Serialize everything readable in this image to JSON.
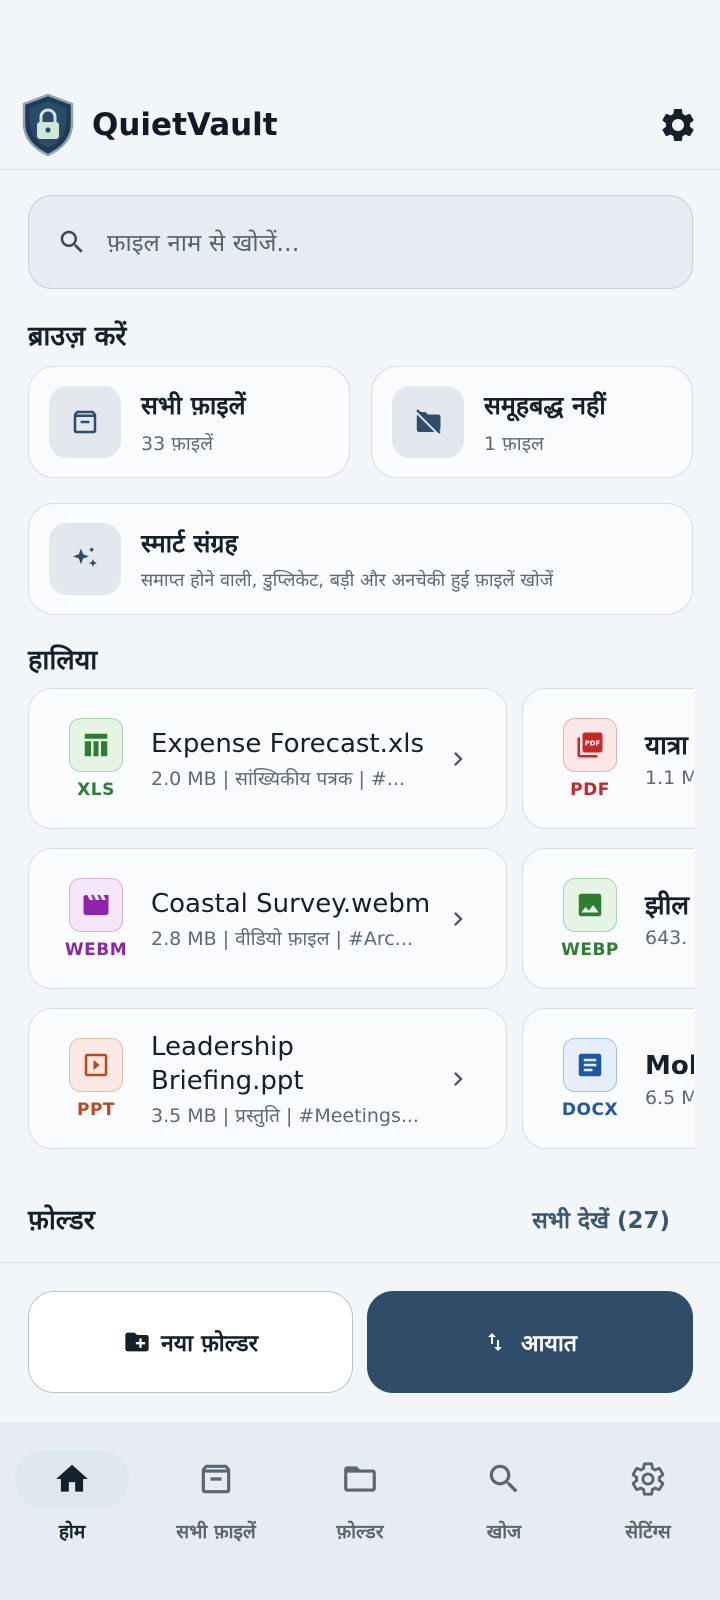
{
  "app": {
    "title": "QuietVault"
  },
  "search": {
    "placeholder": "फ़ाइल नाम से खोजें..."
  },
  "browse": {
    "title": "ब्राउज़ करें",
    "all_files": {
      "label": "सभी फ़ाइलें",
      "count": "33 फ़ाइलें",
      "icon": "archive-icon"
    },
    "ungrouped": {
      "label": "समूहबद्ध नहीं",
      "count": "1 फ़ाइल",
      "icon": "folder-off-icon"
    },
    "smart": {
      "label": "स्मार्ट संग्रह",
      "description": "समाप्त होने वाली, डुप्लिकेट, बड़ी और अनचेकी हुई फ़ाइलें खोजें",
      "icon": "sparkle-icon"
    }
  },
  "recent": {
    "title": "हालिया",
    "files": [
      {
        "type": "XLS",
        "name": "Expense Forecast.xls",
        "meta": "2.0 MB | सांख्यिकीय पत्रक | #...",
        "color": "#2e7d32"
      },
      {
        "type": "WEBM",
        "name": "Coastal Survey.webm",
        "meta": "2.8 MB | वीडियो फ़ाइल | #Arc...",
        "color": "#8e24aa"
      },
      {
        "type": "PPT",
        "name": "Leadership Briefing.ppt",
        "meta": "3.5 MB | प्रस्तुति | #Meetings...",
        "color": "#c0461f"
      }
    ],
    "files_right": [
      {
        "type": "PDF",
        "name": "यात्रा",
        "meta": "1.1 M",
        "color": "#c62828"
      },
      {
        "type": "WEBP",
        "name": "झील",
        "meta": "643.",
        "color": "#2e7d32"
      },
      {
        "type": "DOCX",
        "name": "Mob",
        "meta": "6.5 M",
        "color": "#1e56a8"
      }
    ]
  },
  "folders": {
    "title": "फ़ोल्डर",
    "see_all": "सभी देखें (27)"
  },
  "actions": {
    "new_folder": "नया फ़ोल्डर",
    "import": "आयात"
  },
  "nav": {
    "items": [
      {
        "label": "होम",
        "icon": "home-icon",
        "active": true
      },
      {
        "label": "सभी फ़ाइलें",
        "icon": "archive-icon"
      },
      {
        "label": "फ़ोल्डर",
        "icon": "folder-icon"
      },
      {
        "label": "खोज",
        "icon": "search-icon"
      },
      {
        "label": "सेटिंग्स",
        "icon": "gear-icon"
      }
    ]
  }
}
